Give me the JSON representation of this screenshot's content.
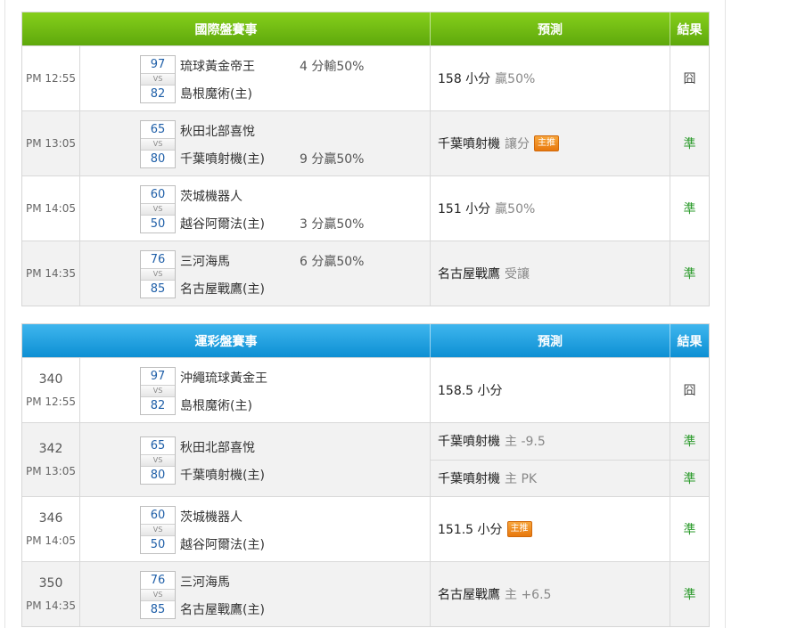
{
  "intl": {
    "header": {
      "match": "國際盤賽事",
      "prediction": "預測",
      "result": "結果"
    },
    "rows": [
      {
        "time": "PM 12:55",
        "score_away": "97",
        "score_home": "82",
        "vs": "VS",
        "team_away": "琉球黃金帝王",
        "team_home": "島根魔術(主)",
        "handicap_away": "4 分輸50%",
        "handicap_home": "",
        "pred_main": "158 小分",
        "pred_grey": "贏50%",
        "pred_badge": "",
        "result": "囧"
      },
      {
        "time": "PM 13:05",
        "score_away": "65",
        "score_home": "80",
        "vs": "VS",
        "team_away": "秋田北部喜悅",
        "team_home": "千葉噴射機(主)",
        "handicap_away": "",
        "handicap_home": "9 分贏50%",
        "pred_main": "千葉噴射機",
        "pred_grey": "讓分",
        "pred_badge": "主推",
        "result": "準"
      },
      {
        "time": "PM 14:05",
        "score_away": "60",
        "score_home": "50",
        "vs": "VS",
        "team_away": "茨城機器人",
        "team_home": "越谷阿爾法(主)",
        "handicap_away": "",
        "handicap_home": "3 分贏50%",
        "pred_main": "151 小分",
        "pred_grey": "贏50%",
        "pred_badge": "",
        "result": "準"
      },
      {
        "time": "PM 14:35",
        "score_away": "76",
        "score_home": "85",
        "vs": "VS",
        "team_away": "三河海馬",
        "team_home": "名古屋戰鷹(主)",
        "handicap_away": "6 分贏50%",
        "handicap_home": "",
        "pred_main": "名古屋戰鷹",
        "pred_grey": "受讓",
        "pred_badge": "",
        "result": "準"
      }
    ]
  },
  "lottery": {
    "header": {
      "match": "運彩盤賽事",
      "prediction": "預測",
      "result": "結果"
    },
    "rows": [
      {
        "num": "340",
        "time": "PM 12:55",
        "score_away": "97",
        "score_home": "82",
        "vs": "VS",
        "team_away": "沖繩琉球黃金王",
        "team_home": "島根魔術(主)",
        "preds": [
          {
            "main": "158.5 小分",
            "grey": "",
            "badge": "",
            "result": "囧"
          }
        ]
      },
      {
        "num": "342",
        "time": "PM 13:05",
        "score_away": "65",
        "score_home": "80",
        "vs": "VS",
        "team_away": "秋田北部喜悅",
        "team_home": "千葉噴射機(主)",
        "preds": [
          {
            "main": "千葉噴射機",
            "grey": "主 -9.5",
            "badge": "",
            "result": "準"
          },
          {
            "main": "千葉噴射機",
            "grey": "主 PK",
            "badge": "",
            "result": "準"
          }
        ]
      },
      {
        "num": "346",
        "time": "PM 14:05",
        "score_away": "60",
        "score_home": "50",
        "vs": "VS",
        "team_away": "茨城機器人",
        "team_home": "越谷阿爾法(主)",
        "preds": [
          {
            "main": "151.5 小分",
            "grey": "",
            "badge": "主推",
            "result": "準"
          }
        ]
      },
      {
        "num": "350",
        "time": "PM 14:35",
        "score_away": "76",
        "score_home": "85",
        "vs": "VS",
        "team_away": "三河海馬",
        "team_home": "名古屋戰鷹(主)",
        "preds": [
          {
            "main": "名古屋戰鷹",
            "grey": "主 +6.5",
            "badge": "",
            "result": "準"
          }
        ]
      }
    ]
  },
  "colors": {
    "intl_header": "#6cbb12",
    "lottery_header": "#1a9ee0",
    "win": "#2a9a2a",
    "badge": "#f0901f"
  }
}
